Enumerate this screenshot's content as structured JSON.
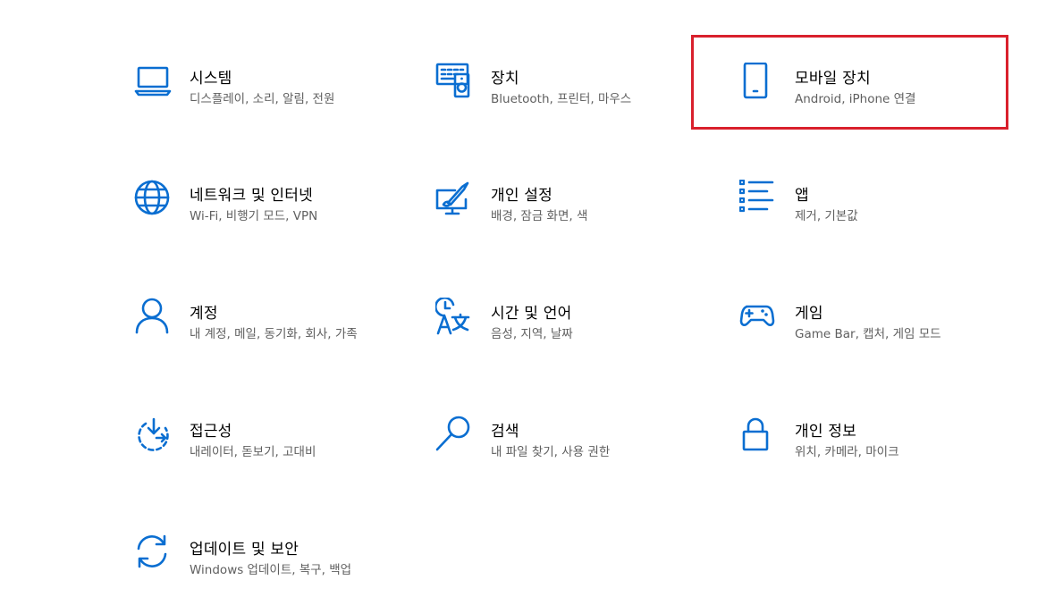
{
  "accent_color": "#0a6ed1",
  "highlight_color": "#d9202c",
  "tiles": [
    {
      "title": "시스템",
      "desc": "디스플레이, 소리, 알림, 전원",
      "icon": "laptop-icon"
    },
    {
      "title": "장치",
      "desc": "Bluetooth, 프린터, 마우스",
      "icon": "devices-icon"
    },
    {
      "title": "모바일 장치",
      "desc": "Android, iPhone 연결",
      "icon": "phone-icon"
    },
    {
      "title": "네트워크 및 인터넷",
      "desc": "Wi-Fi, 비행기 모드, VPN",
      "icon": "globe-icon"
    },
    {
      "title": "개인 설정",
      "desc": "배경, 잠금 화면, 색",
      "icon": "personalization-icon"
    },
    {
      "title": "앱",
      "desc": "제거, 기본값",
      "icon": "apps-list-icon"
    },
    {
      "title": "계정",
      "desc": "내 계정, 메일, 동기화, 회사, 가족",
      "icon": "person-icon"
    },
    {
      "title": "시간 및 언어",
      "desc": "음성, 지역, 날짜",
      "icon": "time-language-icon"
    },
    {
      "title": "게임",
      "desc": "Game Bar, 캡처, 게임 모드",
      "icon": "gamepad-icon"
    },
    {
      "title": "접근성",
      "desc": "내레이터, 돋보기, 고대비",
      "icon": "accessibility-icon"
    },
    {
      "title": "검색",
      "desc": "내 파일 찾기, 사용 권한",
      "icon": "search-icon"
    },
    {
      "title": "개인 정보",
      "desc": "위치, 카메라, 마이크",
      "icon": "lock-icon"
    },
    {
      "title": "업데이트 및 보안",
      "desc": "Windows 업데이트, 복구, 백업",
      "icon": "sync-icon"
    }
  ]
}
